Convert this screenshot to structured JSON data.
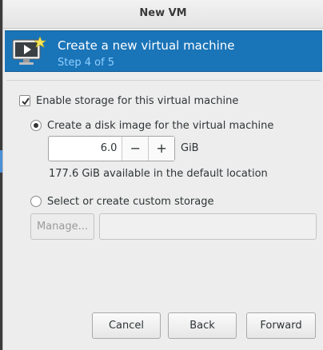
{
  "window": {
    "title": "New VM"
  },
  "banner": {
    "title": "Create a new virtual machine",
    "step": "Step 4 of 5",
    "icon": "monitor-play-icon"
  },
  "storage": {
    "enable_label": "Enable storage for this virtual machine",
    "enable_checked": true,
    "disk_image_label": "Create a disk image for the virtual machine",
    "disk_image_selected": true,
    "size_value": "6.0",
    "size_unit": "GiB",
    "decrement_label": "−",
    "increment_label": "+",
    "available_text": "177.6 GiB available in the default location",
    "custom_label": "Select or create custom storage",
    "custom_selected": false,
    "manage_label": "Manage...",
    "custom_path_value": ""
  },
  "footer": {
    "cancel_label": "Cancel",
    "back_label": "Back",
    "forward_label": "Forward"
  },
  "colors": {
    "banner_bg": "#1a74b8",
    "step_text": "#8fd0ff"
  }
}
